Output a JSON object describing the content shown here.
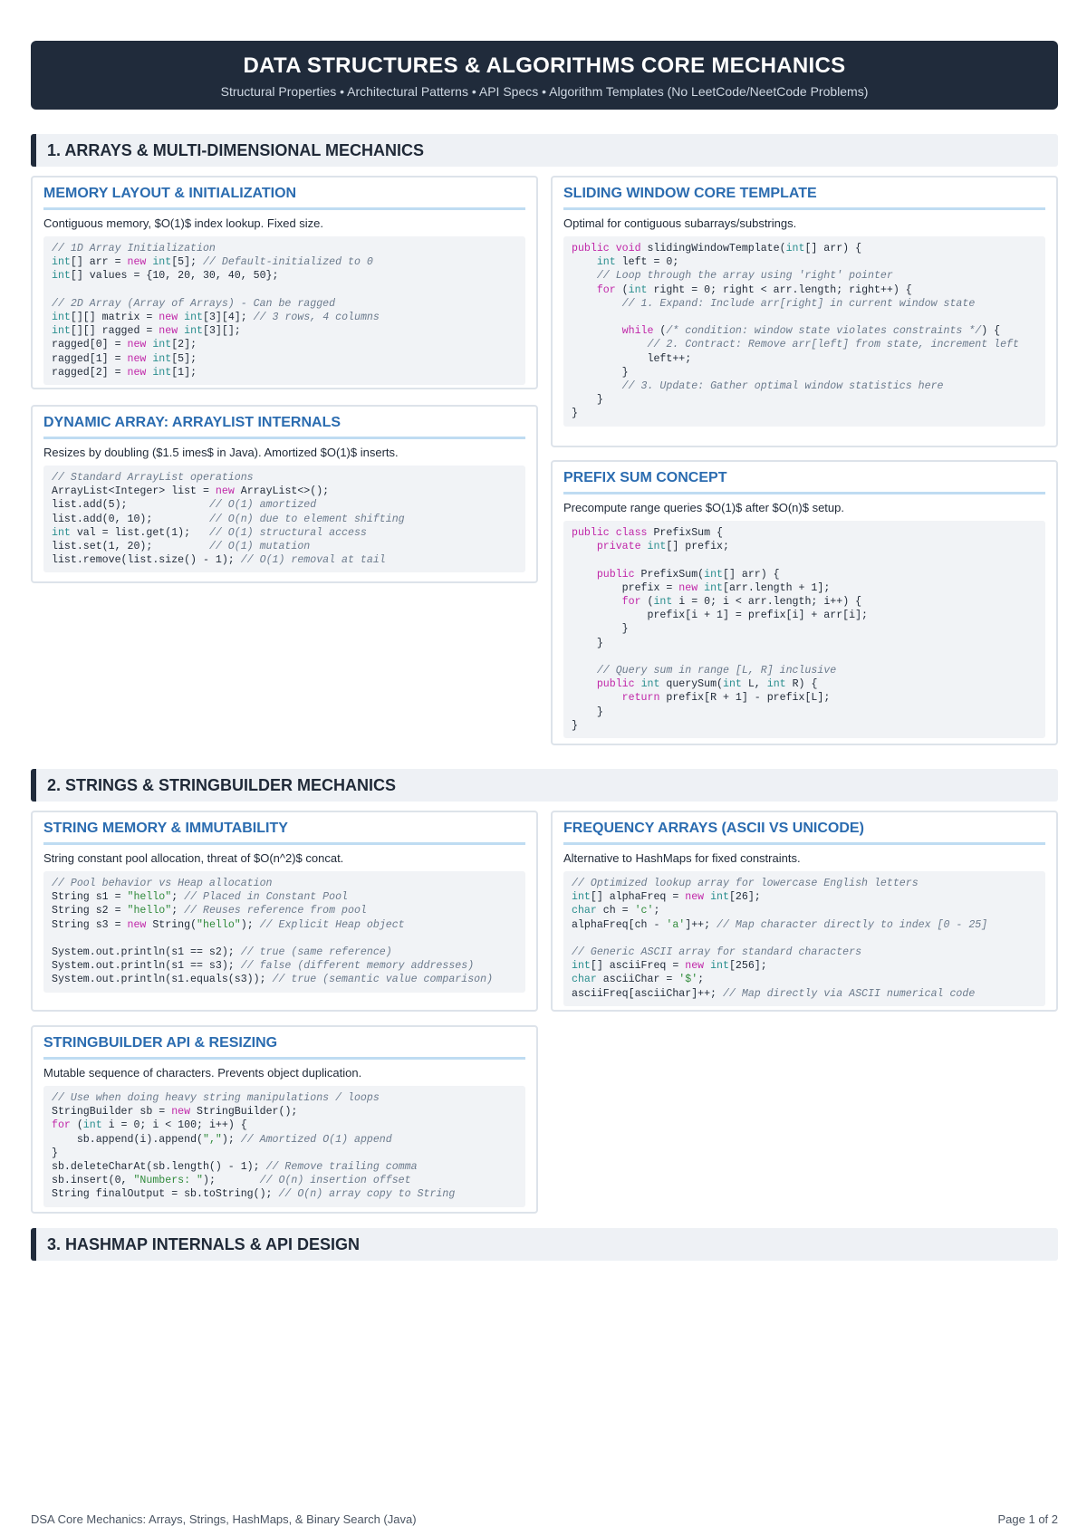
{
  "header": {
    "title": "DATA STRUCTURES & ALGORITHMS CORE MECHANICS",
    "subtitle": "Structural Properties • Architectural Patterns • API Specs • Algorithm Templates (No LeetCode/NeetCode Problems)"
  },
  "sections": {
    "s1": "1. ARRAYS & MULTI-DIMENSIONAL MECHANICS",
    "s2": "2. STRINGS & STRINGBUILDER MECHANICS",
    "s3": "3. HASHMAP INTERNALS & API DESIGN"
  },
  "cards": {
    "memory": {
      "title": "MEMORY LAYOUT & INITIALIZATION",
      "desc": "Contiguous memory, $O(1)$ index lookup. Fixed size.",
      "code": [
        [
          [
            "c",
            "// 1D Array Initialization"
          ]
        ],
        [
          [
            "t",
            "int"
          ],
          [
            "p",
            "[] arr = "
          ],
          [
            "k",
            "new"
          ],
          [
            "p",
            " "
          ],
          [
            "t",
            "int"
          ],
          [
            "p",
            "[5]; "
          ],
          [
            "c",
            "// Default-initialized to 0"
          ]
        ],
        [
          [
            "t",
            "int"
          ],
          [
            "p",
            "[] values = {10, 20, 30, 40, 50};"
          ]
        ],
        [],
        [
          [
            "c",
            "// 2D Array (Array of Arrays) - Can be ragged"
          ]
        ],
        [
          [
            "t",
            "int"
          ],
          [
            "p",
            "[][] matrix = "
          ],
          [
            "k",
            "new"
          ],
          [
            "p",
            " "
          ],
          [
            "t",
            "int"
          ],
          [
            "p",
            "[3][4]; "
          ],
          [
            "c",
            "// 3 rows, 4 columns"
          ]
        ],
        [
          [
            "t",
            "int"
          ],
          [
            "p",
            "[][] ragged = "
          ],
          [
            "k",
            "new"
          ],
          [
            "p",
            " "
          ],
          [
            "t",
            "int"
          ],
          [
            "p",
            "[3][];"
          ]
        ],
        [
          [
            "p",
            "ragged[0] = "
          ],
          [
            "k",
            "new"
          ],
          [
            "p",
            " "
          ],
          [
            "t",
            "int"
          ],
          [
            "p",
            "[2];"
          ]
        ],
        [
          [
            "p",
            "ragged[1] = "
          ],
          [
            "k",
            "new"
          ],
          [
            "p",
            " "
          ],
          [
            "t",
            "int"
          ],
          [
            "p",
            "[5];"
          ]
        ],
        [
          [
            "p",
            "ragged[2] = "
          ],
          [
            "k",
            "new"
          ],
          [
            "p",
            " "
          ],
          [
            "t",
            "int"
          ],
          [
            "p",
            "[1];"
          ]
        ]
      ]
    },
    "sliding": {
      "title": "SLIDING WINDOW CORE TEMPLATE",
      "desc": "Optimal for contiguous subarrays/substrings.",
      "code": [
        [
          [
            "k",
            "public void"
          ],
          [
            "p",
            " slidingWindowTemplate("
          ],
          [
            "t",
            "int"
          ],
          [
            "p",
            "[] arr) {"
          ]
        ],
        [
          [
            "p",
            "    "
          ],
          [
            "t",
            "int"
          ],
          [
            "p",
            " left = 0;"
          ]
        ],
        [
          [
            "p",
            "    "
          ],
          [
            "c",
            "// Loop through the array using 'right' pointer"
          ]
        ],
        [
          [
            "p",
            "    "
          ],
          [
            "k",
            "for"
          ],
          [
            "p",
            " ("
          ],
          [
            "t",
            "int"
          ],
          [
            "p",
            " right = 0; right < arr.length; right++) {"
          ]
        ],
        [
          [
            "p",
            "        "
          ],
          [
            "c",
            "// 1. Expand: Include arr[right] in current window state"
          ]
        ],
        [],
        [
          [
            "p",
            "        "
          ],
          [
            "k",
            "while"
          ],
          [
            "p",
            " ("
          ],
          [
            "c",
            "/* condition: window state violates constraints */"
          ],
          [
            "p",
            ") {"
          ]
        ],
        [
          [
            "p",
            "            "
          ],
          [
            "c",
            "// 2. Contract: Remove arr[left] from state, increment left"
          ]
        ],
        [
          [
            "p",
            "            left++;"
          ]
        ],
        [
          [
            "p",
            "        }"
          ]
        ],
        [
          [
            "p",
            "        "
          ],
          [
            "c",
            "// 3. Update: Gather optimal window statistics here"
          ]
        ],
        [
          [
            "p",
            "    }"
          ]
        ],
        [
          [
            "p",
            "}"
          ]
        ]
      ]
    },
    "arraylist": {
      "title": "DYNAMIC ARRAY: ARRAYLIST INTERNALS",
      "desc": "Resizes by doubling ($1.5 imes$ in Java). Amortized $O(1)$ inserts.",
      "code": [
        [
          [
            "c",
            "// Standard ArrayList operations"
          ]
        ],
        [
          [
            "p",
            "ArrayList<Integer> list = "
          ],
          [
            "k",
            "new"
          ],
          [
            "p",
            " ArrayList<>();"
          ]
        ],
        [
          [
            "p",
            "list.add(5);             "
          ],
          [
            "c",
            "// O(1) amortized"
          ]
        ],
        [
          [
            "p",
            "list.add(0, 10);         "
          ],
          [
            "c",
            "// O(n) due to element shifting"
          ]
        ],
        [
          [
            "t",
            "int"
          ],
          [
            "p",
            " val = list.get(1);   "
          ],
          [
            "c",
            "// O(1) structural access"
          ]
        ],
        [
          [
            "p",
            "list.set(1, 20);         "
          ],
          [
            "c",
            "// O(1) mutation"
          ]
        ],
        [
          [
            "p",
            "list.remove(list.size() - 1); "
          ],
          [
            "c",
            "// O(1) removal at tail"
          ]
        ]
      ]
    },
    "prefix": {
      "title": "PREFIX SUM CONCEPT",
      "desc": "Precompute range queries $O(1)$ after $O(n)$ setup.",
      "code": [
        [
          [
            "k",
            "public class"
          ],
          [
            "p",
            " PrefixSum {"
          ]
        ],
        [
          [
            "p",
            "    "
          ],
          [
            "k",
            "private"
          ],
          [
            "p",
            " "
          ],
          [
            "t",
            "int"
          ],
          [
            "p",
            "[] prefix;"
          ]
        ],
        [],
        [
          [
            "p",
            "    "
          ],
          [
            "k",
            "public"
          ],
          [
            "p",
            " PrefixSum("
          ],
          [
            "t",
            "int"
          ],
          [
            "p",
            "[] arr) {"
          ]
        ],
        [
          [
            "p",
            "        prefix = "
          ],
          [
            "k",
            "new"
          ],
          [
            "p",
            " "
          ],
          [
            "t",
            "int"
          ],
          [
            "p",
            "[arr.length + 1];"
          ]
        ],
        [
          [
            "p",
            "        "
          ],
          [
            "k",
            "for"
          ],
          [
            "p",
            " ("
          ],
          [
            "t",
            "int"
          ],
          [
            "p",
            " i = 0; i < arr.length; i++) {"
          ]
        ],
        [
          [
            "p",
            "            prefix[i + 1] = prefix[i] + arr[i];"
          ]
        ],
        [
          [
            "p",
            "        }"
          ]
        ],
        [
          [
            "p",
            "    }"
          ]
        ],
        [],
        [
          [
            "p",
            "    "
          ],
          [
            "c",
            "// Query sum in range [L, R] inclusive"
          ]
        ],
        [
          [
            "p",
            "    "
          ],
          [
            "k",
            "public"
          ],
          [
            "p",
            " "
          ],
          [
            "t",
            "int"
          ],
          [
            "p",
            " querySum("
          ],
          [
            "t",
            "int"
          ],
          [
            "p",
            " L, "
          ],
          [
            "t",
            "int"
          ],
          [
            "p",
            " R) {"
          ]
        ],
        [
          [
            "p",
            "        "
          ],
          [
            "k",
            "return"
          ],
          [
            "p",
            " prefix[R + 1] - prefix[L];"
          ]
        ],
        [
          [
            "p",
            "    }"
          ]
        ],
        [
          [
            "p",
            "}"
          ]
        ]
      ]
    },
    "stringmem": {
      "title": "STRING MEMORY & IMMUTABILITY",
      "desc": "String constant pool allocation, threat of $O(n^2)$ concat.",
      "code": [
        [
          [
            "c",
            "// Pool behavior vs Heap allocation"
          ]
        ],
        [
          [
            "p",
            "String s1 = "
          ],
          [
            "s",
            "\"hello\""
          ],
          [
            "p",
            "; "
          ],
          [
            "c",
            "// Placed in Constant Pool"
          ]
        ],
        [
          [
            "p",
            "String s2 = "
          ],
          [
            "s",
            "\"hello\""
          ],
          [
            "p",
            "; "
          ],
          [
            "c",
            "// Reuses reference from pool"
          ]
        ],
        [
          [
            "p",
            "String s3 = "
          ],
          [
            "k",
            "new"
          ],
          [
            "p",
            " String("
          ],
          [
            "s",
            "\"hello\""
          ],
          [
            "p",
            "); "
          ],
          [
            "c",
            "// Explicit Heap object"
          ]
        ],
        [],
        [
          [
            "p",
            "System.out.println(s1 == s2); "
          ],
          [
            "c",
            "// true (same reference)"
          ]
        ],
        [
          [
            "p",
            "System.out.println(s1 == s3); "
          ],
          [
            "c",
            "// false (different memory addresses)"
          ]
        ],
        [
          [
            "p",
            "System.out.println(s1.equals(s3)); "
          ],
          [
            "c",
            "// true (semantic value comparison)"
          ]
        ]
      ]
    },
    "frequency": {
      "title": "FREQUENCY ARRAYS (ASCII VS UNICODE)",
      "desc": "Alternative to HashMaps for fixed constraints.",
      "code": [
        [
          [
            "c",
            "// Optimized lookup array for lowercase English letters"
          ]
        ],
        [
          [
            "t",
            "int"
          ],
          [
            "p",
            "[] alphaFreq = "
          ],
          [
            "k",
            "new"
          ],
          [
            "p",
            " "
          ],
          [
            "t",
            "int"
          ],
          [
            "p",
            "[26];"
          ]
        ],
        [
          [
            "t",
            "char"
          ],
          [
            "p",
            " ch = "
          ],
          [
            "s",
            "'c'"
          ],
          [
            "p",
            ";"
          ]
        ],
        [
          [
            "p",
            "alphaFreq[ch - "
          ],
          [
            "s",
            "'a'"
          ],
          [
            "p",
            "]++; "
          ],
          [
            "c",
            "// Map character directly to index [0 - 25]"
          ]
        ],
        [],
        [
          [
            "c",
            "// Generic ASCII array for standard characters"
          ]
        ],
        [
          [
            "t",
            "int"
          ],
          [
            "p",
            "[] asciiFreq = "
          ],
          [
            "k",
            "new"
          ],
          [
            "p",
            " "
          ],
          [
            "t",
            "int"
          ],
          [
            "p",
            "[256];"
          ]
        ],
        [
          [
            "t",
            "char"
          ],
          [
            "p",
            " asciiChar = "
          ],
          [
            "s",
            "'$'"
          ],
          [
            "p",
            ";"
          ]
        ],
        [
          [
            "p",
            "asciiFreq[asciiChar]++; "
          ],
          [
            "c",
            "// Map directly via ASCII numerical code"
          ]
        ]
      ]
    },
    "stringbuilder": {
      "title": "STRINGBUILDER API & RESIZING",
      "desc": "Mutable sequence of characters. Prevents object duplication.",
      "code": [
        [
          [
            "c",
            "// Use when doing heavy string manipulations / loops"
          ]
        ],
        [
          [
            "p",
            "StringBuilder sb = "
          ],
          [
            "k",
            "new"
          ],
          [
            "p",
            " StringBuilder();"
          ]
        ],
        [
          [
            "k",
            "for"
          ],
          [
            "p",
            " ("
          ],
          [
            "t",
            "int"
          ],
          [
            "p",
            " i = 0; i < 100; i++) {"
          ]
        ],
        [
          [
            "p",
            "    sb.append(i).append("
          ],
          [
            "s",
            "\",\""
          ],
          [
            "p",
            "); "
          ],
          [
            "c",
            "// Amortized O(1) append"
          ]
        ],
        [
          [
            "p",
            "}"
          ]
        ],
        [
          [
            "p",
            "sb.deleteCharAt(sb.length() - 1); "
          ],
          [
            "c",
            "// Remove trailing comma"
          ]
        ],
        [
          [
            "p",
            "sb.insert(0, "
          ],
          [
            "s",
            "\"Numbers: \""
          ],
          [
            "p",
            ");       "
          ],
          [
            "c",
            "// O(n) insertion offset"
          ]
        ],
        [
          [
            "p",
            "String finalOutput = sb.toString(); "
          ],
          [
            "c",
            "// O(n) array copy to String"
          ]
        ]
      ]
    }
  },
  "footer": {
    "left": "DSA Core Mechanics: Arrays, Strings, HashMaps, & Binary Search (Java)",
    "right": "Page 1 of 2"
  }
}
